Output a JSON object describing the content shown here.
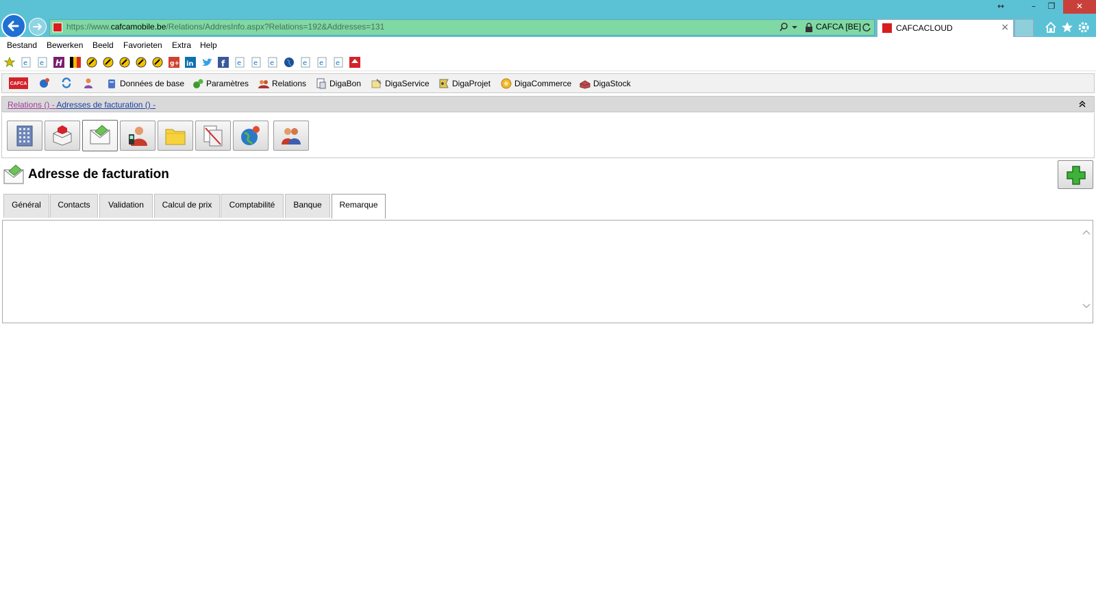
{
  "browser": {
    "address": {
      "url_prefix": "https://www.",
      "url_host": "cafcamobile.be",
      "url_path": "/Relations/AddresInfo.aspx?Relations=192&Addresses=131",
      "site_identity": "CAFCA [BE]"
    },
    "tab": {
      "title": "CAFCACLOUD",
      "close": "×"
    },
    "window_controls": {
      "resize": "↔",
      "minimize": "–",
      "restore": "❐",
      "close": "✕"
    }
  },
  "menu": {
    "items": [
      {
        "label": "Bestand"
      },
      {
        "label": "Bewerken"
      },
      {
        "label": "Beeld"
      },
      {
        "label": "Favorieten"
      },
      {
        "label": "Extra"
      },
      {
        "label": "Help"
      }
    ]
  },
  "app_toolbar": {
    "logo": "CAFCA",
    "items": [
      {
        "label": "Données de base",
        "icon": "database-icon"
      },
      {
        "label": "Paramètres",
        "icon": "settings-icon"
      },
      {
        "label": "Relations",
        "icon": "relations-icon"
      },
      {
        "label": "DigaBon",
        "icon": "digabon-icon"
      },
      {
        "label": "DigaService",
        "icon": "digaservice-icon"
      },
      {
        "label": "DigaProjet",
        "icon": "digaprojet-icon"
      },
      {
        "label": "DigaCommerce",
        "icon": "digacommerce-icon"
      },
      {
        "label": "DigaStock",
        "icon": "digastock-icon"
      }
    ]
  },
  "breadcrumb": {
    "relations": "Relations ()",
    "sep1": " - ",
    "adresses": "Adresses de facturation ()",
    "sep2": " -"
  },
  "icon_strip": [
    {
      "icon": "building-icon"
    },
    {
      "icon": "delivery-address-icon"
    },
    {
      "icon": "billing-address-icon",
      "active": true
    },
    {
      "icon": "contact-phone-icon"
    },
    {
      "icon": "folder-icon"
    },
    {
      "icon": "documents-icon"
    },
    {
      "icon": "globe-icon"
    },
    {
      "icon": "users-icon"
    }
  ],
  "form": {
    "title": "Adresse de facturation",
    "tabs": [
      {
        "label": "Général"
      },
      {
        "label": "Contacts"
      },
      {
        "label": "Validation"
      },
      {
        "label": "Calcul de prix"
      },
      {
        "label": "Comptabilité"
      },
      {
        "label": "Banque"
      },
      {
        "label": "Remarque",
        "active": true
      }
    ],
    "remark_value": ""
  },
  "colors": {
    "chrome_bg": "#5bc2d6",
    "address_bg": "#7fd9a4",
    "close_red": "#c9403a",
    "breadcrumb_visited": "#a03b9f",
    "breadcrumb_link": "#1f3ea1",
    "add_green": "#3fb13a"
  }
}
